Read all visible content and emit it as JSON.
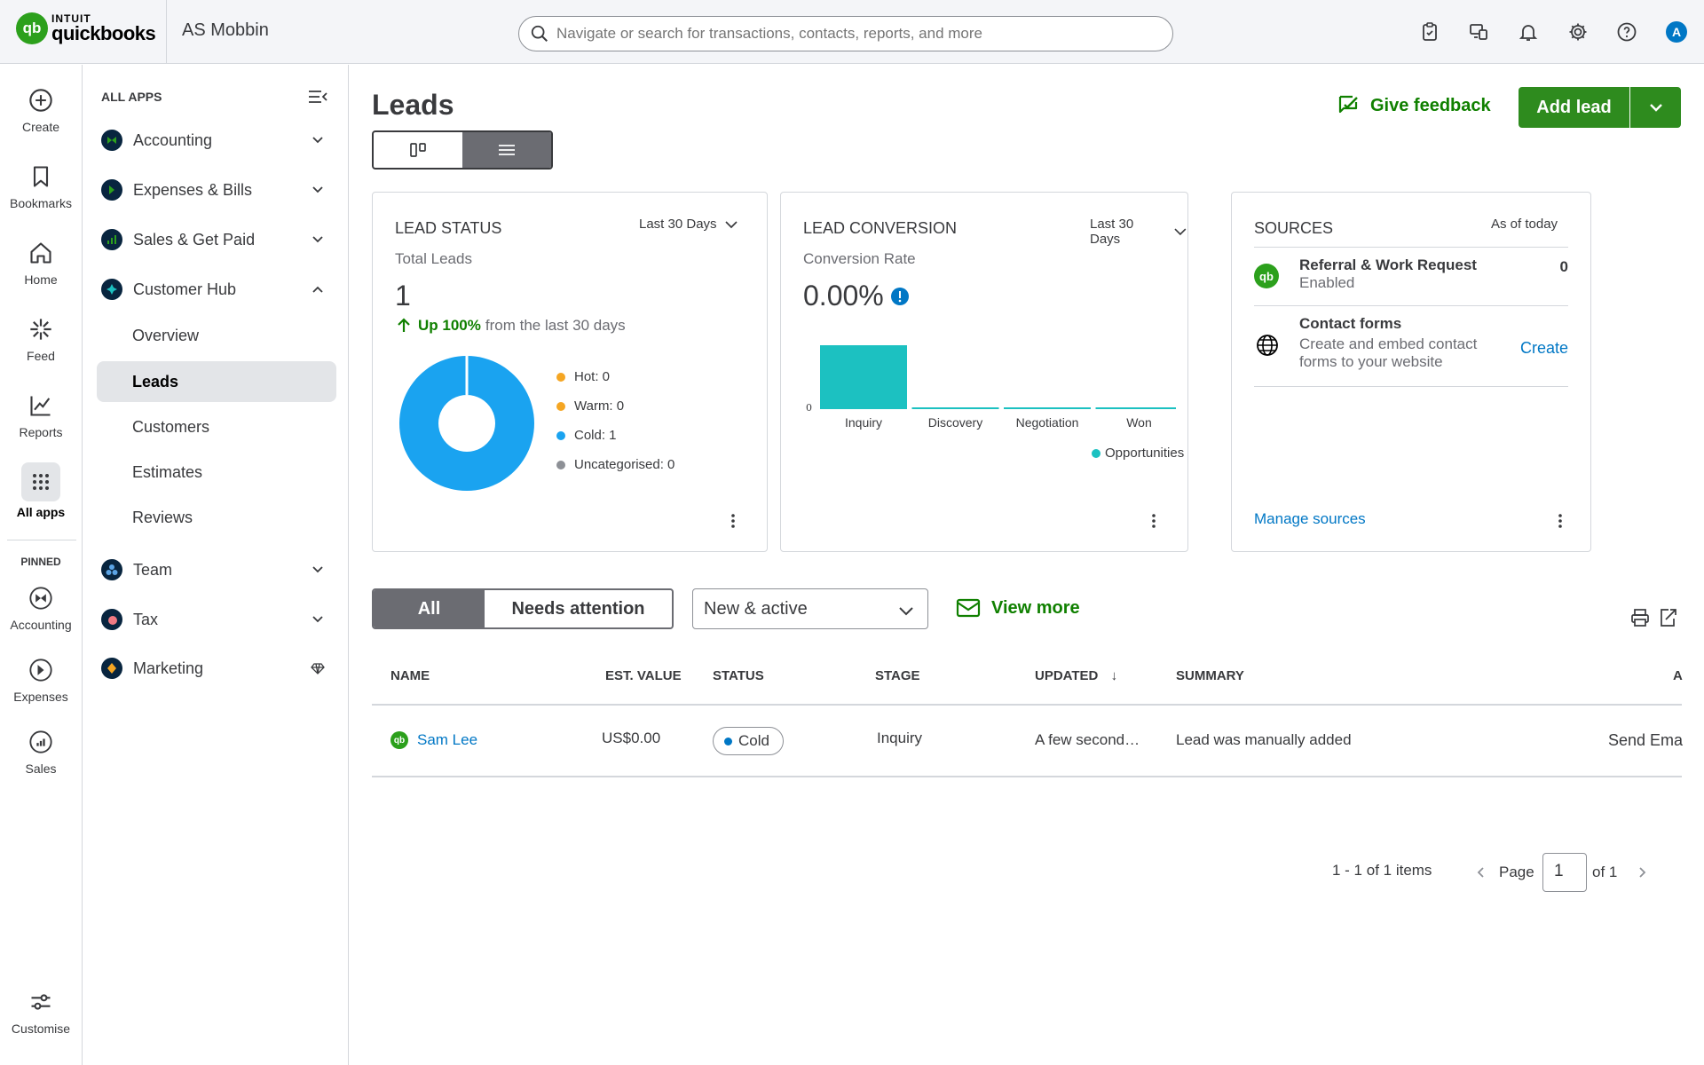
{
  "brand": {
    "intuit": "INTUIT",
    "product": "quickbooks",
    "mark": "qb"
  },
  "company": "AS Mobbin",
  "search": {
    "placeholder": "Navigate or search for transactions, contacts, reports, and more"
  },
  "header_icons": [
    "clipboard-icon",
    "apps-switch-icon",
    "bell-icon",
    "gear-icon",
    "help-icon"
  ],
  "user_initial": "A",
  "rail": {
    "items": [
      {
        "label": "Create",
        "icon": "plus-circle-icon"
      },
      {
        "label": "Bookmarks",
        "icon": "bookmark-icon"
      },
      {
        "label": "Home",
        "icon": "home-icon"
      },
      {
        "label": "Feed",
        "icon": "sparkle-icon"
      },
      {
        "label": "Reports",
        "icon": "line-chart-icon"
      },
      {
        "label": "All apps",
        "icon": "grid-dots-icon"
      }
    ],
    "pinned_label": "PINNED",
    "pinned": [
      {
        "label": "Accounting",
        "icon": "accounting-icon"
      },
      {
        "label": "Expenses",
        "icon": "expenses-icon"
      },
      {
        "label": "Sales",
        "icon": "sales-icon"
      }
    ],
    "customise": "Customise"
  },
  "nav": {
    "heading": "ALL APPS",
    "apps": [
      {
        "label": "Accounting",
        "color": "#08253f"
      },
      {
        "label": "Expenses & Bills",
        "color": "#08253f"
      },
      {
        "label": "Sales & Get Paid",
        "color": "#08253f"
      },
      {
        "label": "Customer Hub",
        "color": "#08253f"
      }
    ],
    "sub": [
      "Overview",
      "Leads",
      "Customers",
      "Estimates",
      "Reviews"
    ],
    "apps2": [
      {
        "label": "Team"
      },
      {
        "label": "Tax"
      },
      {
        "label": "Marketing"
      }
    ]
  },
  "page": {
    "title": "Leads",
    "feedback": "Give feedback",
    "add_lead": "Add lead"
  },
  "lead_status": {
    "title": "LEAD STATUS",
    "range": "Last 30 Days",
    "sub": "Total Leads",
    "total": "1",
    "trend_up": "Up 100%",
    "trend_rest": "from the last 30 days",
    "legend": [
      "Hot: 0",
      "Warm: 0",
      "Cold: 1",
      "Uncategorised: 0"
    ],
    "colors": [
      "#f5a623",
      "#f5a623",
      "#1aa3f0",
      "#8d9096"
    ]
  },
  "lead_conversion": {
    "title": "LEAD CONVERSION",
    "range": "Last 30 Days",
    "sub": "Conversion Rate",
    "rate": "0.00%",
    "zero_tick": "0",
    "legend": "Opportunities",
    "bar_color": "#1cc1c1"
  },
  "chart_data": [
    {
      "type": "pie",
      "labels": [
        "Hot",
        "Warm",
        "Cold",
        "Uncategorised"
      ],
      "values": [
        0,
        0,
        1,
        0
      ]
    },
    {
      "type": "bar",
      "categories": [
        "Inquiry",
        "Discovery",
        "Negotiation",
        "Won"
      ],
      "series": [
        {
          "name": "Opportunities",
          "values": [
            1,
            0,
            0,
            0
          ]
        }
      ]
    }
  ],
  "sources": {
    "title": "SOURCES",
    "as_of": "As of today",
    "rows": [
      {
        "title": "Referral & Work Request",
        "sub": "Enabled",
        "value": "0"
      },
      {
        "title": "Contact forms",
        "sub1": "Create and embed contact",
        "sub2": "forms to your website",
        "action": "Create"
      }
    ],
    "manage": "Manage sources"
  },
  "filters": {
    "all": "All",
    "needs_attention": "Needs attention",
    "select": "New & active",
    "view_more": "View more"
  },
  "table": {
    "headers": [
      "NAME",
      "EST. VALUE",
      "STATUS",
      "STAGE",
      "UPDATED",
      "SUMMARY",
      "A"
    ],
    "sort_arrow": "↓",
    "rows": [
      {
        "name": "Sam Lee",
        "value": "US$0.00",
        "status": "Cold",
        "stage": "Inquiry",
        "updated": "A few second…",
        "summary": "Lead was manually added",
        "action": "Send Ema"
      }
    ]
  },
  "pagination": {
    "items": "1 - 1 of 1 items",
    "page_label": "Page",
    "page": "1",
    "of": "of 1"
  }
}
